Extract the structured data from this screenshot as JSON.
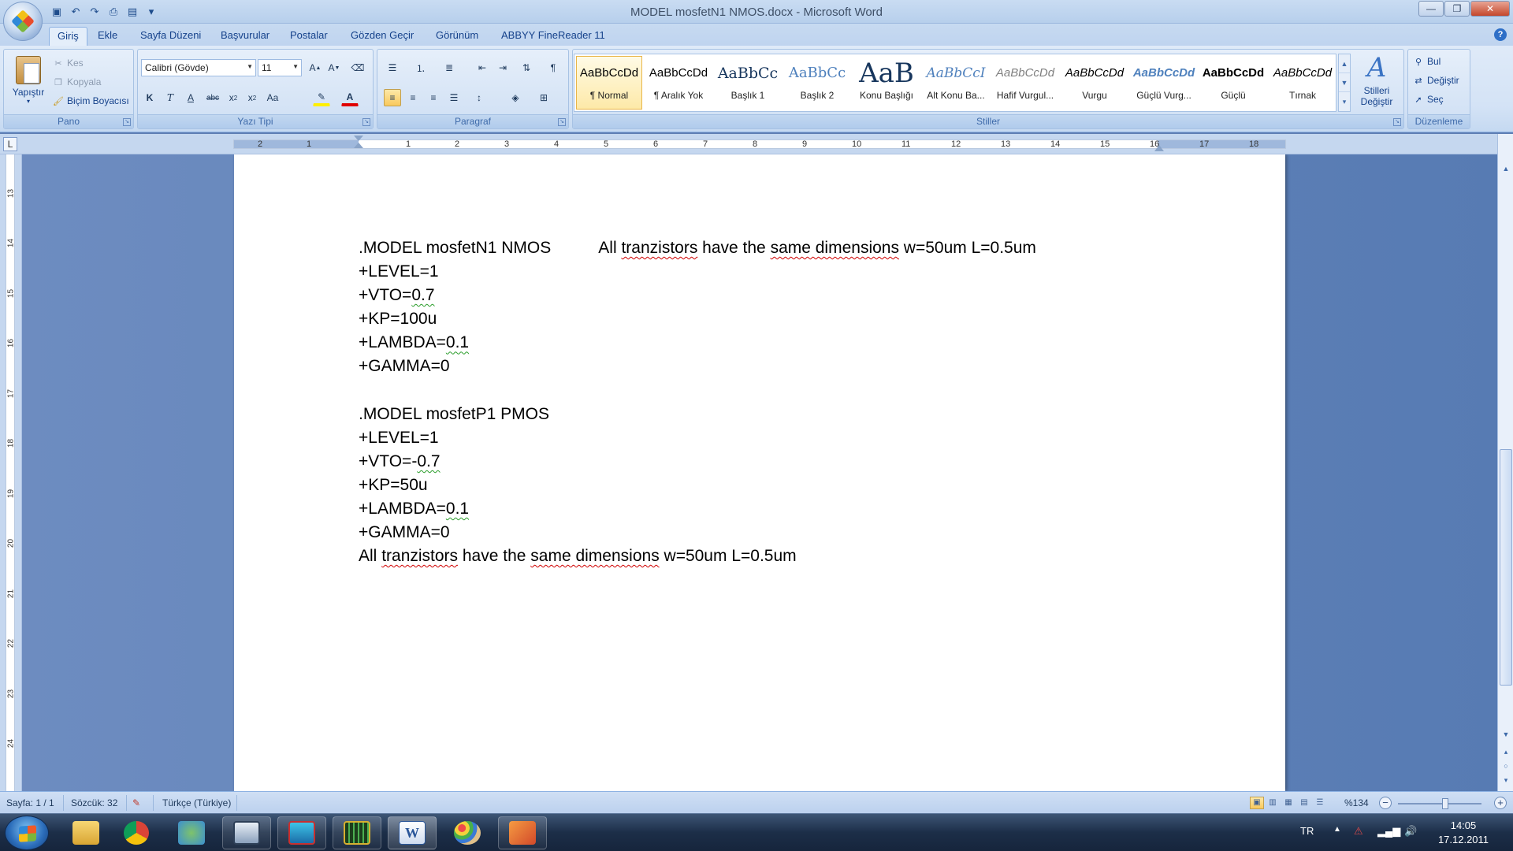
{
  "window": {
    "title": "MODEL mosfetN1 NMOS.docx - Microsoft Word",
    "controls": {
      "minimize": "—",
      "maximize": "❐",
      "close": "✕"
    }
  },
  "qat": [
    {
      "name": "save-icon",
      "glyph": "💾"
    },
    {
      "name": "undo-icon",
      "glyph": "↶"
    },
    {
      "name": "redo-icon",
      "glyph": "↷"
    },
    {
      "name": "print-icon",
      "glyph": "🖶"
    },
    {
      "name": "print-preview-icon",
      "glyph": "🔍"
    },
    {
      "name": "customize-icon",
      "glyph": "▾"
    }
  ],
  "tabs": [
    "Giriş",
    "Ekle",
    "Sayfa Düzeni",
    "Başvurular",
    "Postalar",
    "Gözden Geçir",
    "Görünüm",
    "ABBYY FineReader 11"
  ],
  "groups": {
    "pano": "Pano",
    "yazi_tipi": "Yazı Tipi",
    "paragraf": "Paragraf",
    "stiller": "Stiller",
    "duzenleme": "Düzenleme"
  },
  "clipboard": {
    "paste": "Yapıştır",
    "cut": "Kes",
    "copy": "Kopyala",
    "format_painter": "Biçim Boyacısı"
  },
  "font": {
    "family": "Calibri (Gövde)",
    "size": "11"
  },
  "styles": [
    {
      "preview": "AaBbCcDd",
      "name": "¶ Normal"
    },
    {
      "preview": "AaBbCcDd",
      "name": "¶ Aralık Yok"
    },
    {
      "preview": "AaBbCc",
      "name": "Başlık 1"
    },
    {
      "preview": "AaBbCc",
      "name": "Başlık 2"
    },
    {
      "preview": "AaB",
      "name": "Konu Başlığı"
    },
    {
      "preview": "AaBbCcI",
      "name": "Alt Konu Ba..."
    },
    {
      "preview": "AaBbCcDd",
      "name": "Hafif Vurgul..."
    },
    {
      "preview": "AaBbCcDd",
      "name": "Vurgu"
    },
    {
      "preview": "AaBbCcDd",
      "name": "Güçlü Vurg..."
    },
    {
      "preview": "AaBbCcDd",
      "name": "Güçlü"
    },
    {
      "preview": "AaBbCcDd",
      "name": "Tırnak"
    }
  ],
  "change_styles": {
    "line1": "Stilleri",
    "line2": "Değiştir"
  },
  "editing": {
    "find": "Bul",
    "replace": "Değiştir",
    "select": "Seç"
  },
  "ruler": {
    "h_numbers": [
      "2",
      "1",
      "1",
      "2",
      "3",
      "4",
      "5",
      "6",
      "7",
      "8",
      "9",
      "10",
      "11",
      "12",
      "13",
      "14",
      "15",
      "16",
      "17",
      "18"
    ],
    "v_numbers": [
      "13",
      "14",
      "15",
      "16",
      "17",
      "18",
      "19",
      "20",
      "21",
      "22",
      "23",
      "24"
    ]
  },
  "document": {
    "line1_a": ".MODEL mosfetN1 NMOS",
    "line1_b_pre": "All ",
    "line1_b_word1": "tranzistors",
    "line1_b_mid": " have the ",
    "line1_b_word2": "same dimensions",
    "line1_b_post": " w=50um L=0.5um",
    "n_level": "+LEVEL=1",
    "n_vto_pre": "+VTO=",
    "n_vto_val": "0.7",
    "n_kp": "+KP=100u",
    "n_lambda_pre": "+LAMBDA=",
    "n_lambda_val": "0.1",
    "n_gamma": "+GAMMA=0",
    "p_model": ".MODEL mosfetP1 PMOS",
    "p_level": "+LEVEL=1",
    "p_vto_pre": "+VTO=-",
    "p_vto_val": "0.7",
    "p_kp": "+KP=50u",
    "p_lambda_pre": "+LAMBDA=",
    "p_lambda_val": "0.1",
    "p_gamma": "+GAMMA=0",
    "last_pre": "All ",
    "last_word1": "tranzistors",
    "last_mid": " have the ",
    "last_word2": "same dimensions",
    "last_post": " w=50um L=0.5um"
  },
  "status": {
    "page": "Sayfa: 1 / 1",
    "words": "Sözcük: 32",
    "language": "Türkçe (Türkiye)",
    "zoom": "%134"
  },
  "tray": {
    "lang": "TR",
    "time": "14:05",
    "date": "17.12.2011"
  },
  "colors": {
    "ribbon": "#d4e3f6",
    "accent": "#15428b",
    "taskbar": "#1c2e48",
    "page": "#ffffff"
  }
}
